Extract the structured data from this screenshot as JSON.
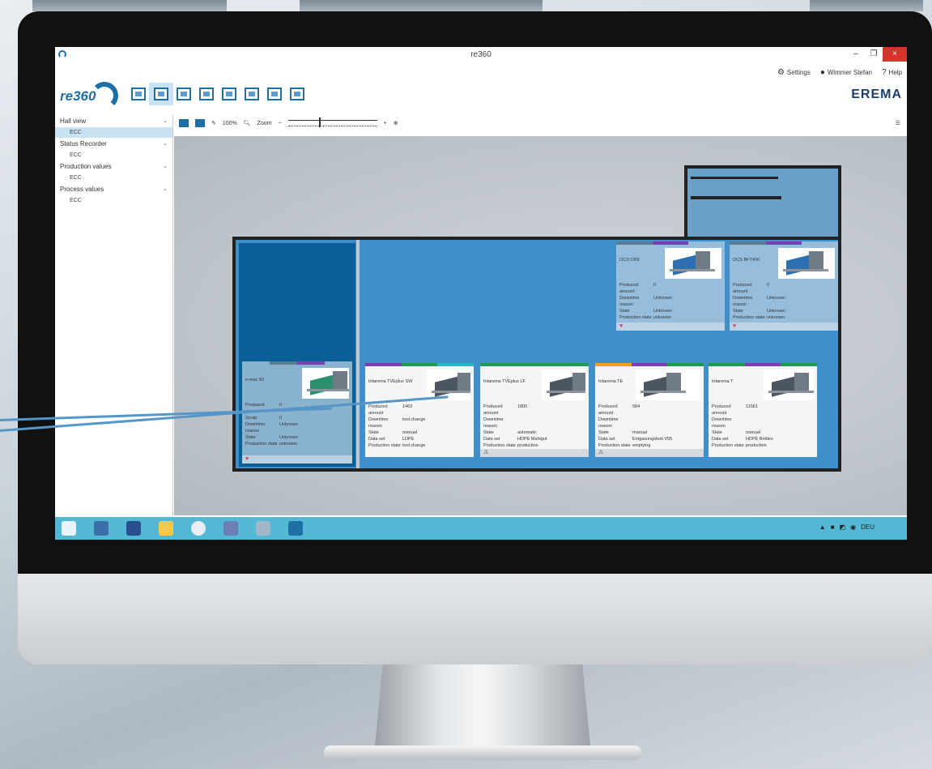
{
  "window": {
    "title": "re360",
    "minimize": "–",
    "restore": "❐",
    "close": "×"
  },
  "topbar": {
    "settings": "Settings",
    "user": "Wimmer Stefan",
    "help": "Help"
  },
  "header": {
    "logo_text": "re360",
    "brand": "EREMA"
  },
  "sidebar": {
    "groups": [
      {
        "label": "Hall view",
        "item": "ECC"
      },
      {
        "label": "Status Recorder",
        "item": "ECC"
      },
      {
        "label": "Production values",
        "item": "ECC"
      },
      {
        "label": "Process values",
        "item": "ECC"
      }
    ]
  },
  "content_toolbar": {
    "zoom_percent": "100%",
    "zoom_label": "Zoom",
    "minus": "−",
    "plus": "+"
  },
  "machines": {
    "ocs_cr9": {
      "name": "OCS CR9",
      "produced_amount": "0",
      "downtime_reason": "Unknown",
      "state": "Unknown",
      "production_state": "unknown"
    },
    "ocs_bft400": {
      "name": "OCS BFT400",
      "produced_amount": "0",
      "downtime_reason": "Unknown",
      "state": "Unknown",
      "production_state": "unknown"
    },
    "e_mac": {
      "name": "e-mac 50",
      "produced_amount": "0",
      "scrap": "0",
      "downtime_reason": "Unknown",
      "state": "Unknown",
      "production_state": "unknown"
    },
    "tveplus_sw": {
      "name": "Intarema TVEplus SW",
      "produced_amount": "1463",
      "downtime_reason": "tool change",
      "state": "manual",
      "data_set": "LDPE",
      "production_state": "tool change"
    },
    "tveplus_lf": {
      "name": "Intarema TVEplus LF",
      "produced_amount": "1800",
      "downtime_reason": "",
      "state": "automatic",
      "data_set": "HDPE Mahlgut",
      "production_state": "production"
    },
    "te": {
      "name": "Intarema TE",
      "produced_amount": "584",
      "downtime_reason": "",
      "state": "manual",
      "data_set": "Entgasungstest V55",
      "production_state": "emptying"
    },
    "t": {
      "name": "Intarema T",
      "produced_amount": "11561",
      "downtime_reason": "",
      "state": "manual",
      "data_set": "HDPE Bottles",
      "production_state": "production"
    }
  },
  "labels": {
    "produced_amount": "Produced amount",
    "downtime_reason": "Downtime reason",
    "state": "State",
    "data_set": "Data set",
    "production_state": "Production state",
    "scrap": "Scrap"
  },
  "taskbar": {
    "language": "DEU"
  },
  "colors": {
    "accent": "#1d6fa5",
    "taskbar": "#53b8d3",
    "hall": "#3f8fca",
    "status_purple": "#7b3fb3",
    "status_green": "#1f9a57",
    "status_orange": "#f0a017",
    "status_teal": "#2fb3c9"
  }
}
